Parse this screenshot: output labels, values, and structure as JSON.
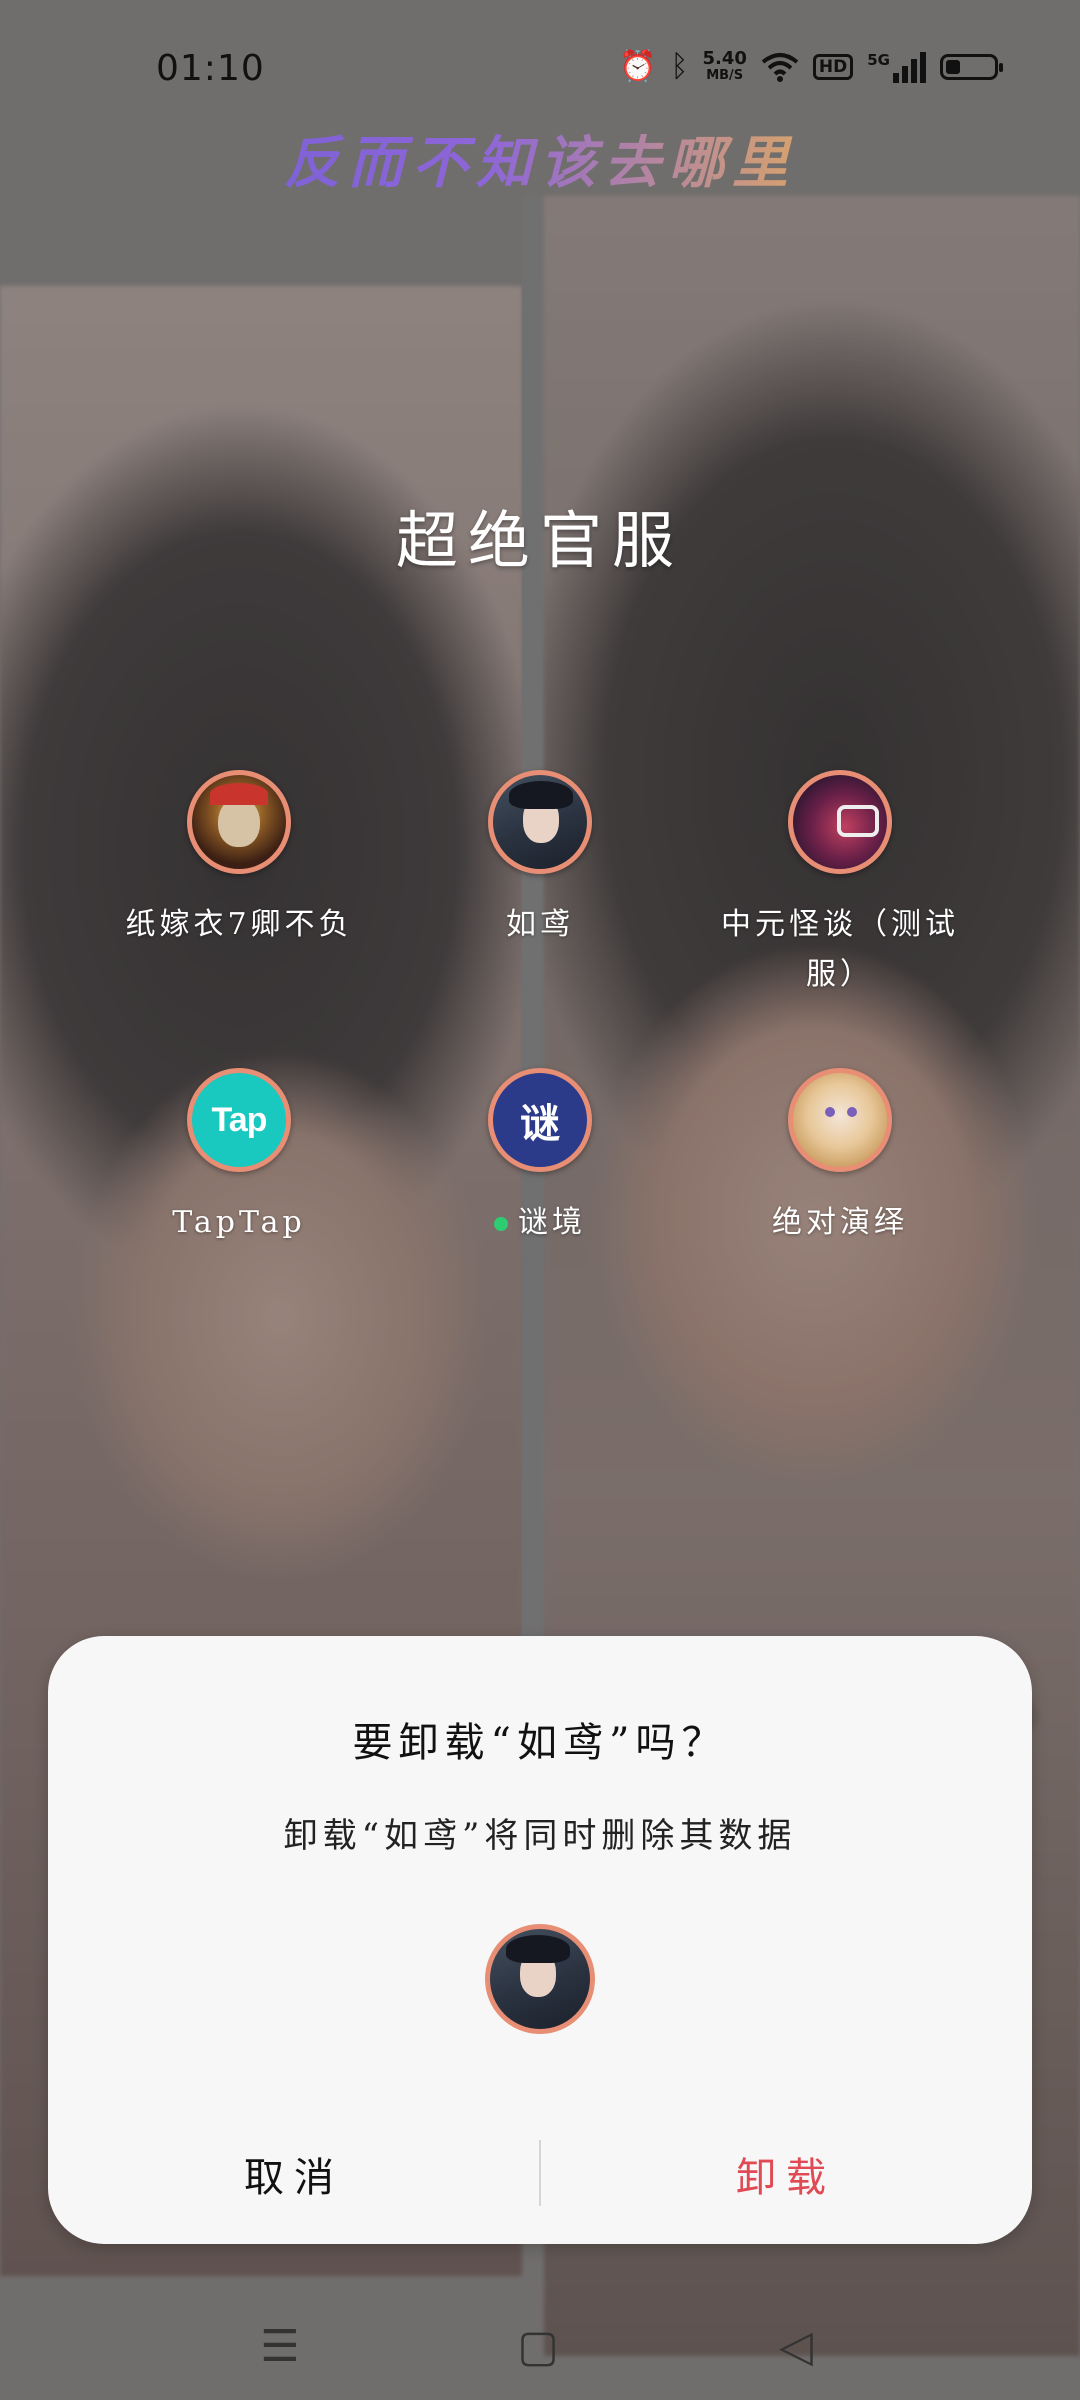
{
  "status_bar": {
    "time": "01:10",
    "net_speed_value": "5.40",
    "net_speed_unit": "MB/S",
    "hd_label": "HD",
    "network_label": "5G",
    "icons": [
      "alarm-icon",
      "bluetooth-icon",
      "wifi-icon",
      "signal-icon",
      "battery-icon"
    ],
    "battery_level": 0.3
  },
  "banner_text": "反而不知该去哪里",
  "folder": {
    "title": "超绝官服",
    "apps": [
      {
        "label": "纸嫁衣7卿不负",
        "icon": "bride-icon"
      },
      {
        "label": "如鸢",
        "icon": "character-icon"
      },
      {
        "label": "中元怪谈（测试服）",
        "icon": "ghost-story-icon"
      },
      {
        "label": "TapTap",
        "icon": "taptap-icon",
        "icon_text": "Tap"
      },
      {
        "label": "谜境",
        "icon": "mijing-icon",
        "icon_text": "谜",
        "new_dot": true
      },
      {
        "label": "绝对演绎",
        "icon": "anime-girl-icon"
      }
    ]
  },
  "dialog": {
    "title": "要卸载“如鸢”吗？",
    "message": "卸载“如鸢”将同时删除其数据",
    "cancel_label": "取消",
    "confirm_label": "卸载",
    "confirm_color": "#e04a55"
  },
  "nav": {
    "menu_icon": "☰",
    "home_icon": "▢",
    "back_icon": "◁"
  },
  "colors": {
    "icon_ring": "#e78e74",
    "new_dot": "#2ecc71"
  }
}
